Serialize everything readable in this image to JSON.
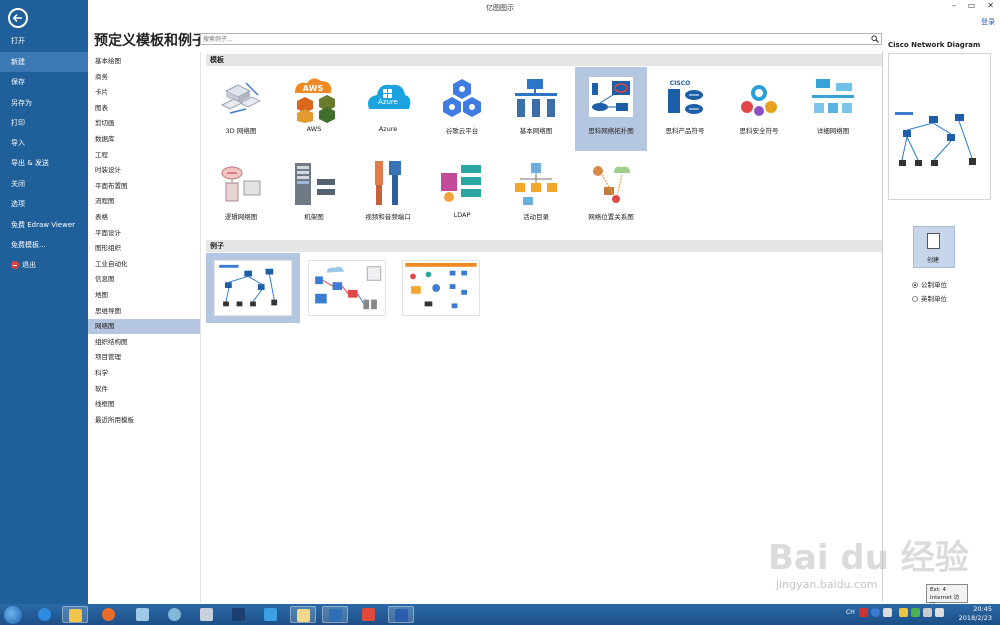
{
  "window": {
    "title": "亿图图示",
    "login": "登录",
    "minimize": "–",
    "restore": "▭",
    "close": "✕"
  },
  "sidebar": {
    "items": [
      {
        "label": "打开"
      },
      {
        "label": "新建",
        "active": true
      },
      {
        "label": "保存"
      },
      {
        "label": "另存为"
      },
      {
        "label": "打印"
      },
      {
        "label": "导入"
      },
      {
        "label": "导出 & 发送"
      },
      {
        "label": "关闭"
      },
      {
        "label": "选项"
      },
      {
        "label": "免费 Edraw Viewer"
      },
      {
        "label": "免费模板..."
      },
      {
        "label": "退出"
      }
    ]
  },
  "page": {
    "title": "预定义模板和例子",
    "search_placeholder": "搜索例子..."
  },
  "categories": [
    "基本绘图",
    "商务",
    "卡片",
    "图表",
    "剪切画",
    "数据库",
    "工程",
    "时装设计",
    "平面布置图",
    "流程图",
    "表格",
    "平面设计",
    "图形组织",
    "工业自动化",
    "信息图",
    "地图",
    "思维导图",
    "网络图",
    "组织结构图",
    "项目管理",
    "科学",
    "软件",
    "线框图",
    "最近所用模板"
  ],
  "active_category": "网络图",
  "sections": {
    "templates": "模板",
    "examples": "例子"
  },
  "templates": [
    {
      "label": "3D 网络图",
      "icon": "3d-network-icon"
    },
    {
      "label": "AWS",
      "icon": "aws-icon",
      "badge": "AWS"
    },
    {
      "label": "Azure",
      "icon": "azure-icon",
      "badge": "Azure"
    },
    {
      "label": "谷歌云平台",
      "icon": "google-cloud-icon"
    },
    {
      "label": "基本网络图",
      "icon": "basic-network-icon"
    },
    {
      "label": "思科网络拓扑图",
      "icon": "cisco-topology-icon",
      "selected": true
    },
    {
      "label": "思科产品符号",
      "icon": "cisco-product-icon",
      "badge": "CISCO"
    },
    {
      "label": "思科安全符号",
      "icon": "cisco-security-icon"
    },
    {
      "label": "详细网络图",
      "icon": "detailed-network-icon"
    },
    {
      "label": "逻辑网络图",
      "icon": "logical-network-icon"
    },
    {
      "label": "机架图",
      "icon": "rack-icon"
    },
    {
      "label": "视频和音频端口",
      "icon": "av-ports-icon"
    },
    {
      "label": "LDAP",
      "icon": "ldap-icon"
    },
    {
      "label": "活动目录",
      "icon": "active-directory-icon"
    },
    {
      "label": "网络位置关系图",
      "icon": "network-location-icon"
    }
  ],
  "examples": [
    {
      "name": "example-1",
      "selected": true
    },
    {
      "name": "example-2"
    },
    {
      "name": "example-3"
    }
  ],
  "preview": {
    "title": "Cisco Network Diagram"
  },
  "create": {
    "label": "创建"
  },
  "units": {
    "metric": "公制单位",
    "imperial": "英制单位",
    "selected": "metric"
  },
  "tooltip": {
    "line1": "Ext: 4",
    "line2": "Internet 访问"
  },
  "watermark": {
    "main": "Bai du 经验",
    "sub": "jingyan.baidu.com"
  },
  "taskbar": {
    "lang": "CH",
    "time": "20:45",
    "date": "2018/2/23"
  },
  "colors": {
    "sidebar": "#1f5f9a",
    "selection": "#b5c6e0",
    "accent": "#1e5eb7"
  }
}
